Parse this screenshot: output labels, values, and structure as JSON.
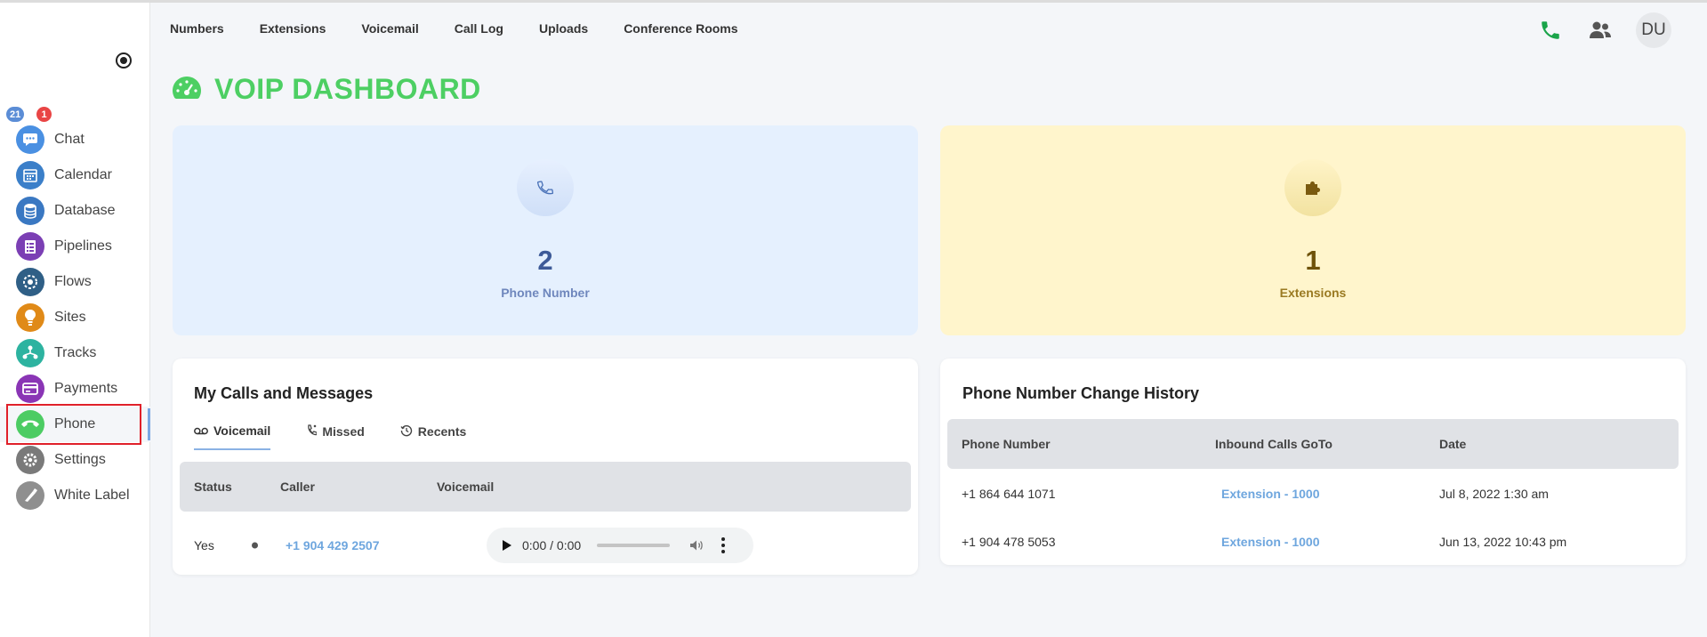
{
  "sidebar": {
    "badges": {
      "chat_blue": "21",
      "chat_red": "1"
    },
    "items": [
      {
        "label": "Chat",
        "icon": "chat-icon",
        "color": "#4a90e2"
      },
      {
        "label": "Calendar",
        "icon": "calendar-icon",
        "color": "#3b7fc9"
      },
      {
        "label": "Database",
        "icon": "database-icon",
        "color": "#3a78c2"
      },
      {
        "label": "Pipelines",
        "icon": "pipelines-icon",
        "color": "#7b3fb4"
      },
      {
        "label": "Flows",
        "icon": "flows-icon",
        "color": "#2f5f86"
      },
      {
        "label": "Sites",
        "icon": "sites-icon",
        "color": "#e08a18"
      },
      {
        "label": "Tracks",
        "icon": "tracks-icon",
        "color": "#2db3a0"
      },
      {
        "label": "Payments",
        "icon": "payments-icon",
        "color": "#8a35b5"
      },
      {
        "label": "Phone",
        "icon": "phone-icon",
        "color": "#4ccc63"
      },
      {
        "label": "Settings",
        "icon": "settings-icon",
        "color": "#7a7a7a"
      },
      {
        "label": "White Label",
        "icon": "white-label-icon",
        "color": "#8f8f8f"
      }
    ]
  },
  "topnav": [
    "Numbers",
    "Extensions",
    "Voicemail",
    "Call Log",
    "Uploads",
    "Conference Rooms"
  ],
  "user": {
    "initials": "DU"
  },
  "page": {
    "title": "VOIP DASHBOARD",
    "accent": "#4dcf63"
  },
  "stats": {
    "phone_numbers": {
      "value": "2",
      "label": "Phone Number"
    },
    "extensions": {
      "value": "1",
      "label": "Extensions"
    }
  },
  "calls": {
    "title": "My Calls and Messages",
    "tabs": [
      "Voicemail",
      "Missed",
      "Recents"
    ],
    "columns": [
      "Status",
      "Caller",
      "Voicemail"
    ],
    "rows": [
      {
        "status": "Yes",
        "caller": "+1 904 429 2507",
        "time": "0:00 / 0:00"
      }
    ]
  },
  "history": {
    "title": "Phone Number Change History",
    "columns": [
      "Phone Number",
      "Inbound Calls GoTo",
      "Date"
    ],
    "rows": [
      {
        "number": "+1 864 644 1071",
        "goto": "Extension - 1000",
        "date": "Jul 8, 2022 1:30 am"
      },
      {
        "number": "+1 904 478 5053",
        "goto": "Extension - 1000",
        "date": "Jun 13, 2022 10:43 pm"
      }
    ]
  }
}
